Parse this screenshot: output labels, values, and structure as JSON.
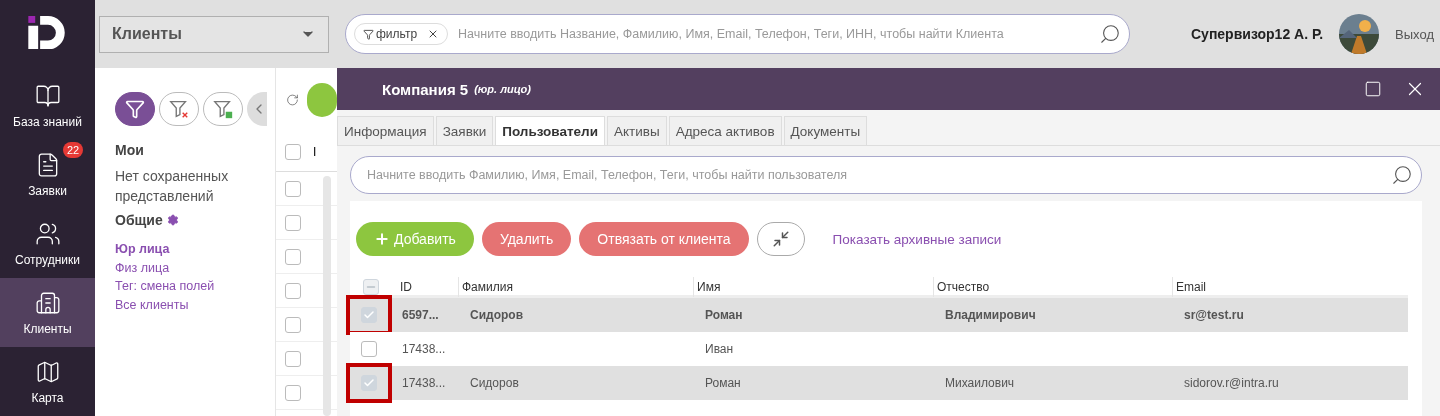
{
  "nav": {
    "items": [
      {
        "label": "База знаний",
        "selected": false
      },
      {
        "label": "Заявки",
        "selected": false,
        "badge": "22"
      },
      {
        "label": "Сотрудники",
        "selected": false
      },
      {
        "label": "Клиенты",
        "selected": true
      },
      {
        "label": "Карта",
        "selected": false
      }
    ]
  },
  "top_bar": {
    "section_select": "Клиенты",
    "search": {
      "chip": "фильтр",
      "placeholder": "Начните вводить Название, Фамилию, Имя, Email, Телефон, Теги, ИНН, чтобы найти Клиента"
    },
    "user": "Супервизор12 А. Р.",
    "logout": "Выход"
  },
  "filter_panel": {
    "my_title": "Мои",
    "my_empty": "Нет сохраненных представлений",
    "common_title": "Общие",
    "views": [
      {
        "label": "Юр лица",
        "selected": true
      },
      {
        "label": "Физ лица",
        "selected": false
      },
      {
        "label": "Тег: смена полей",
        "selected": false
      },
      {
        "label": "Все клиенты",
        "selected": false
      }
    ]
  },
  "background_list": {
    "column": "I",
    "header_checked": false,
    "rows": [
      {
        "checked": false
      },
      {
        "checked": false
      },
      {
        "checked": false
      },
      {
        "checked": false
      },
      {
        "checked": false
      },
      {
        "checked": false
      },
      {
        "checked": false
      }
    ]
  },
  "modal": {
    "title": "Компания 5",
    "subtitle": "(юр. лицо)",
    "tabs": [
      {
        "label": "Информация",
        "selected": false
      },
      {
        "label": "Заявки",
        "selected": false
      },
      {
        "label": "Пользователи",
        "selected": true
      },
      {
        "label": "Активы",
        "selected": false
      },
      {
        "label": "Адреса активов",
        "selected": false
      },
      {
        "label": "Документы",
        "selected": false
      }
    ],
    "search_placeholder": "Начните вводить Фамилию, Имя, Email, Телефон, Теги, чтобы найти пользователя",
    "buttons": [
      {
        "label": "Добавить",
        "kind": "add"
      },
      {
        "label": "Удалить",
        "kind": "danger"
      },
      {
        "label": "Отвязать от клиента",
        "kind": "danger"
      }
    ],
    "archive_link": "Показать архивные записи",
    "table": {
      "select_all_partial": true,
      "columns": [
        "ID",
        "Фамилия",
        "Имя",
        "Отчество",
        "Email"
      ],
      "rows": [
        {
          "selected": true,
          "bold": true,
          "outlined": true,
          "cells": [
            "6597...",
            "Сидоров",
            "Роман",
            "Владимирович",
            "sr@test.ru"
          ]
        },
        {
          "selected": false,
          "bold": false,
          "outlined": false,
          "cells": [
            "17438...",
            "",
            "Иван",
            "",
            ""
          ]
        },
        {
          "selected": true,
          "bold": false,
          "outlined": true,
          "cells": [
            "17438...",
            "Сидоров",
            "Роман",
            "Михаилович",
            "sidorov.r@intra.ru"
          ]
        }
      ]
    }
  }
}
